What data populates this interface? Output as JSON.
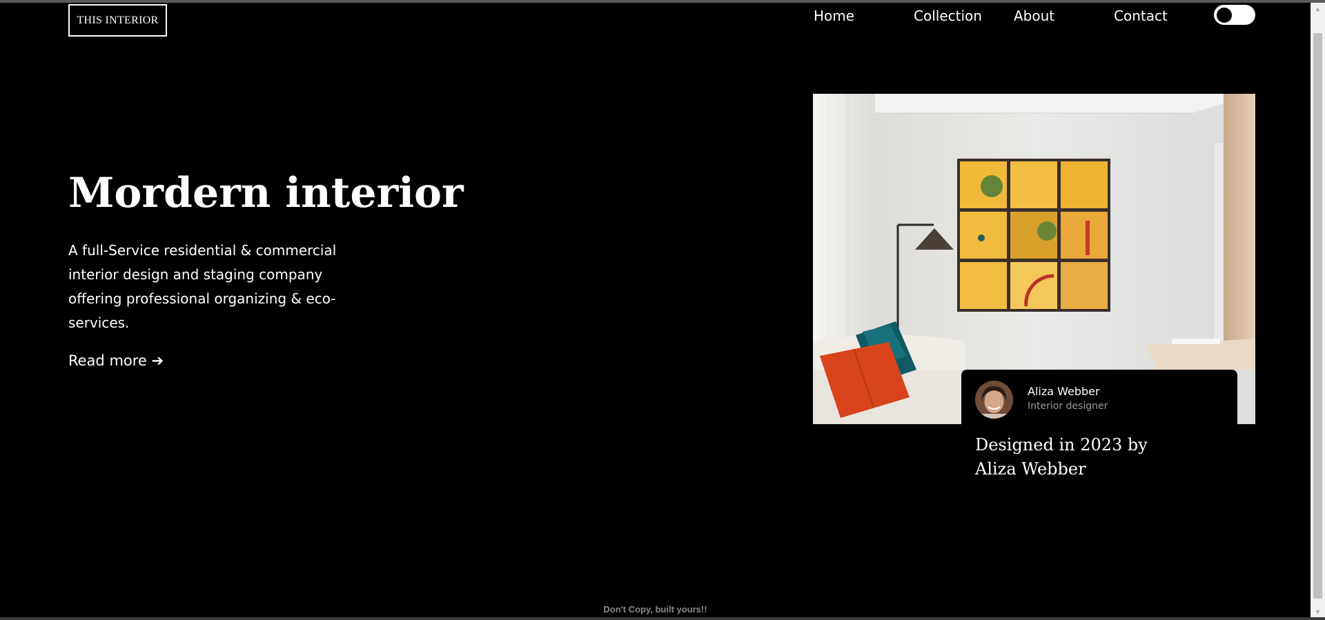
{
  "header": {
    "logo_text": "THIS INTERIOR",
    "nav": {
      "home": "Home",
      "collection": "Collection",
      "about": "About",
      "contact": "Contact"
    },
    "theme_toggle": {
      "icon": "toggle-switch-icon",
      "state": "off"
    }
  },
  "hero": {
    "title": "Mordern interior",
    "description": "A full-Service residential & commercial interior design and staging company offering professional organizing & eco-services.",
    "read_more": "Read more ➔"
  },
  "featured": {
    "image": "living-room-interior-photo",
    "designer": {
      "name": "Aliza Webber",
      "role": "Interior designer",
      "avatar": "designer-avatar"
    },
    "credit": "Designed in 2023 by Aliza Webber"
  },
  "footer": {
    "note": "Don't Copy, built yours!!"
  },
  "colors": {
    "background": "#000000",
    "text": "#ffffff",
    "muted": "#9a9a9a"
  }
}
